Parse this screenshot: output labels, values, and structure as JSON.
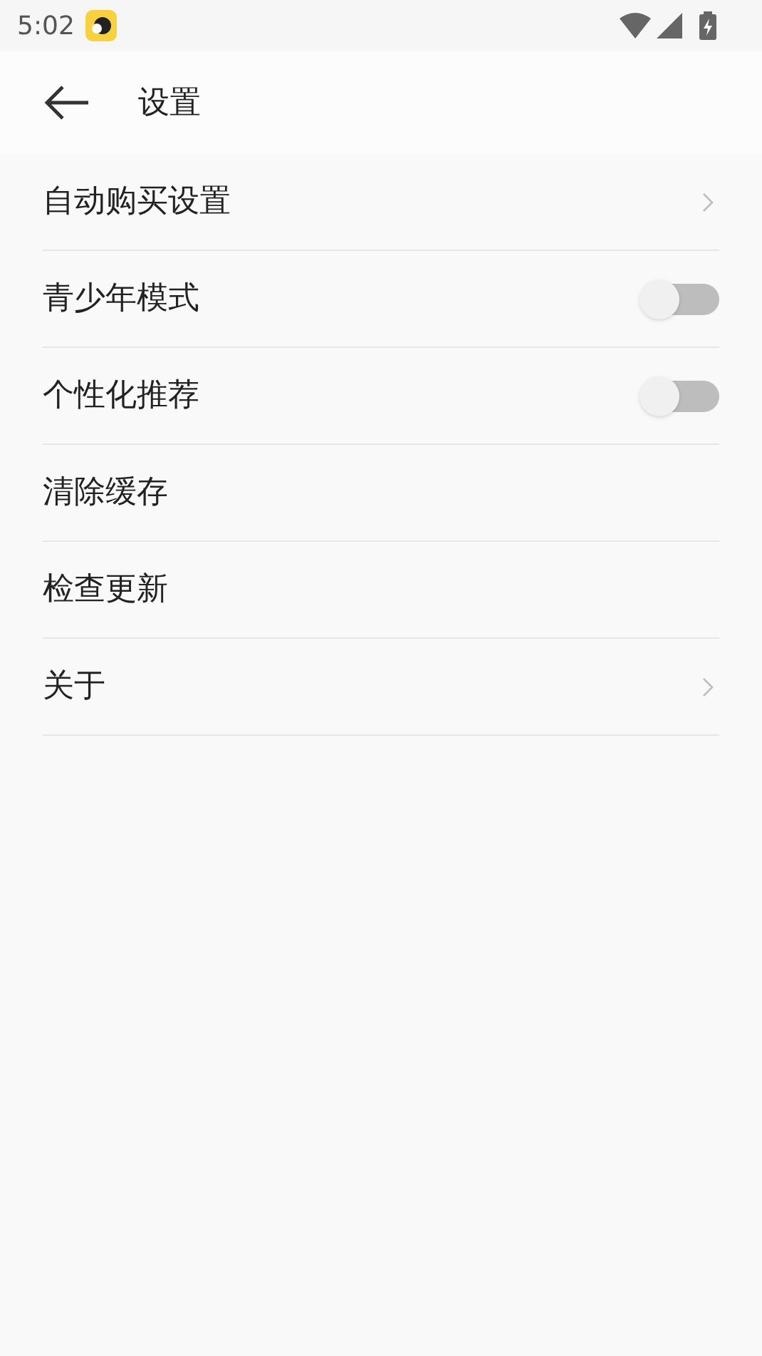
{
  "status_bar": {
    "time": "5:02"
  },
  "header": {
    "title": "设置"
  },
  "items": [
    {
      "label": "自动购买设置",
      "kind": "link"
    },
    {
      "label": "青少年模式",
      "kind": "switch",
      "on": false
    },
    {
      "label": "个性化推荐",
      "kind": "switch",
      "on": false
    },
    {
      "label": "清除缓存",
      "kind": "plain"
    },
    {
      "label": "检查更新",
      "kind": "plain"
    },
    {
      "label": "关于",
      "kind": "link"
    }
  ]
}
